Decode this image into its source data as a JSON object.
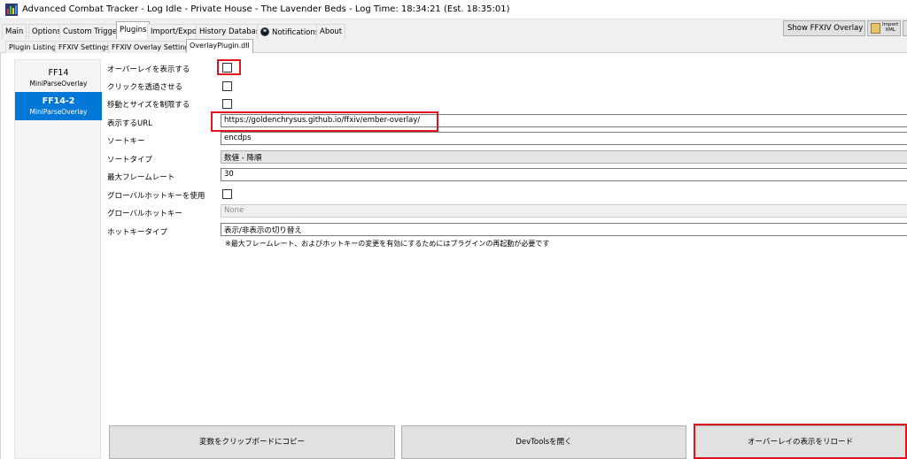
{
  "window": {
    "title": "Advanced Combat Tracker - Log Idle - Private House - The Lavender Beds - Log Time: 18:34:21 (Est. 18:35:01)",
    "app_icon": "act-app-icon"
  },
  "main_tabs": [
    "Main",
    "Options",
    "Custom Triggers",
    "Plugins",
    "Import/Export",
    "History Database",
    "Notifications",
    "About"
  ],
  "main_active_tab": "Plugins",
  "toolbar": {
    "show_overlay_label": "Show FFXIV Overlay",
    "import_label_1": "Import",
    "import_label_2": "XML"
  },
  "sub_tabs": [
    "Plugin Listing",
    "FFXIV Settings",
    "FFXIV Overlay Settings",
    "OverlayPlugin.dll"
  ],
  "sub_active_tab": "OverlayPlugin.dll",
  "sidebar": {
    "items": [
      {
        "name": "FF14",
        "type": "MiniParseOverlay"
      },
      {
        "name": "FF14-2",
        "type": "MiniParseOverlay"
      }
    ]
  },
  "settings": {
    "show_overlay_label": "オーバーレイを表示する",
    "click_through_label": "クリックを透過させる",
    "limit_move_resize_label": "移動とサイズを制限する",
    "url_label": "表示するURL",
    "url_value": "https://goldenchrysus.github.io/ffxiv/ember-overlay/",
    "sort_key_label": "ソートキー",
    "sort_key_value": "encdps",
    "sort_type_label": "ソートタイプ",
    "sort_type_value": "数値 - 降順",
    "max_framerate_label": "最大フレームレート",
    "max_framerate_value": "30",
    "use_global_hotkey_label": "グローバルホットキーを使用",
    "global_hotkey_label": "グローバルホットキー",
    "global_hotkey_value": "None",
    "hotkey_type_label": "ホットキータイプ",
    "hotkey_type_value": "表示/非表示の切り替え",
    "restart_note": "※最大フレームレート、およびホットキーの変更を有効にするためにはプラグインの再起動が必要です"
  },
  "buttons": {
    "copy_vars": "変数をクリップボードにコピー",
    "devtools": "DevToolsを開く",
    "reload_overlay": "オーバーレイの表示をリロード"
  },
  "colors": {
    "highlight": "#e0141e",
    "selection": "#0078d7"
  }
}
